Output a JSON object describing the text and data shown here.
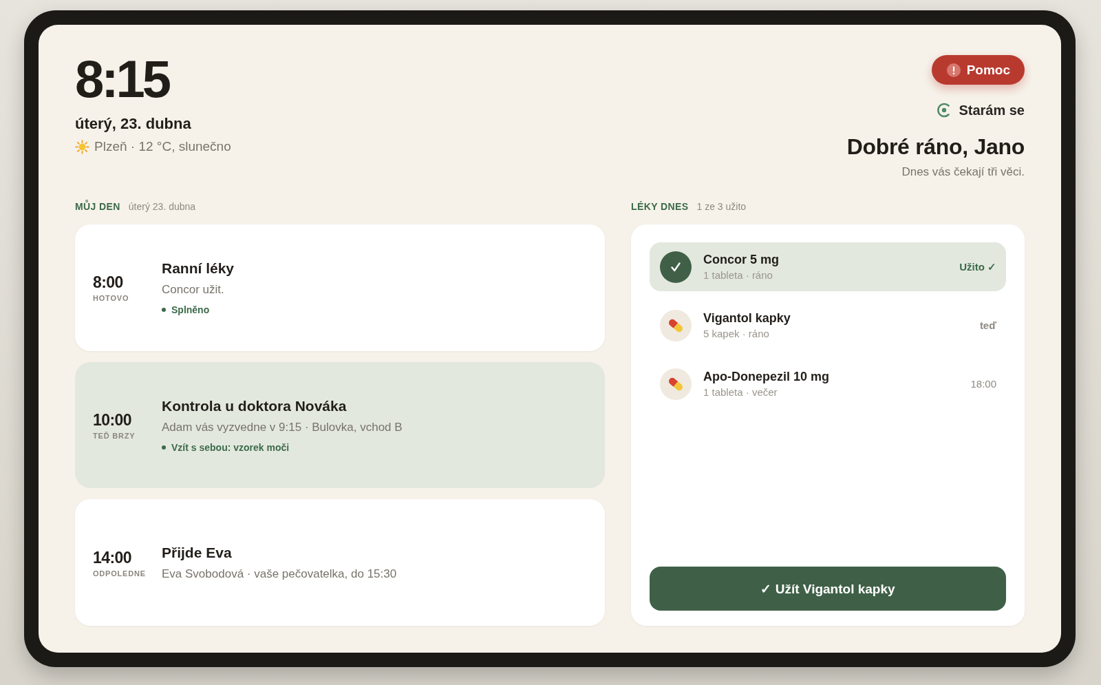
{
  "clock": {
    "time": "8:15",
    "date": "úterý, 23. dubna",
    "weather": "Plzeň · 12 °C, slunečno"
  },
  "help_button": {
    "label": "Pomoc"
  },
  "mode": {
    "label": "Starám se"
  },
  "greeting": {
    "title": "Dobré ráno, Jano",
    "subtitle": "Dnes vás čekají tři věci."
  },
  "day": {
    "heading": "MŮJ DEN",
    "date": "úterý 23. dubna",
    "events": [
      {
        "time": "8:00",
        "status": "HOTOVO",
        "title": "Ranní léky",
        "detail": "Concor užit.",
        "note": "Splněno",
        "current": false
      },
      {
        "time": "10:00",
        "status": "TEĎ BRZY",
        "title": "Kontrola u doktora Nováka",
        "detail": "Adam vás vyzvedne v 9:15 · Bulovka, vchod B",
        "note": "Vzít s sebou: vzorek moči",
        "current": true
      },
      {
        "time": "14:00",
        "status": "ODPOLEDNE",
        "title": "Přijde Eva",
        "detail": "Eva Svobodová · vaše pečovatelka, do 15:30",
        "current": false
      }
    ]
  },
  "medications": {
    "heading": "LÉKY DNES",
    "summary": "1 ze 3 užito",
    "items": [
      {
        "name": "Concor 5 mg",
        "dose": "1 tableta · ráno",
        "status": "Užito ✓",
        "taken": true,
        "due": false
      },
      {
        "name": "Vigantol kapky",
        "dose": "5 kapek · ráno",
        "status": "teď",
        "taken": false,
        "due": true
      },
      {
        "name": "Apo-Donepezil 10 mg",
        "dose": "1 tableta · večer",
        "status": "18:00",
        "taken": false,
        "due": false
      }
    ],
    "action": {
      "label": "✓ Užít Vigantol kapky"
    }
  }
}
